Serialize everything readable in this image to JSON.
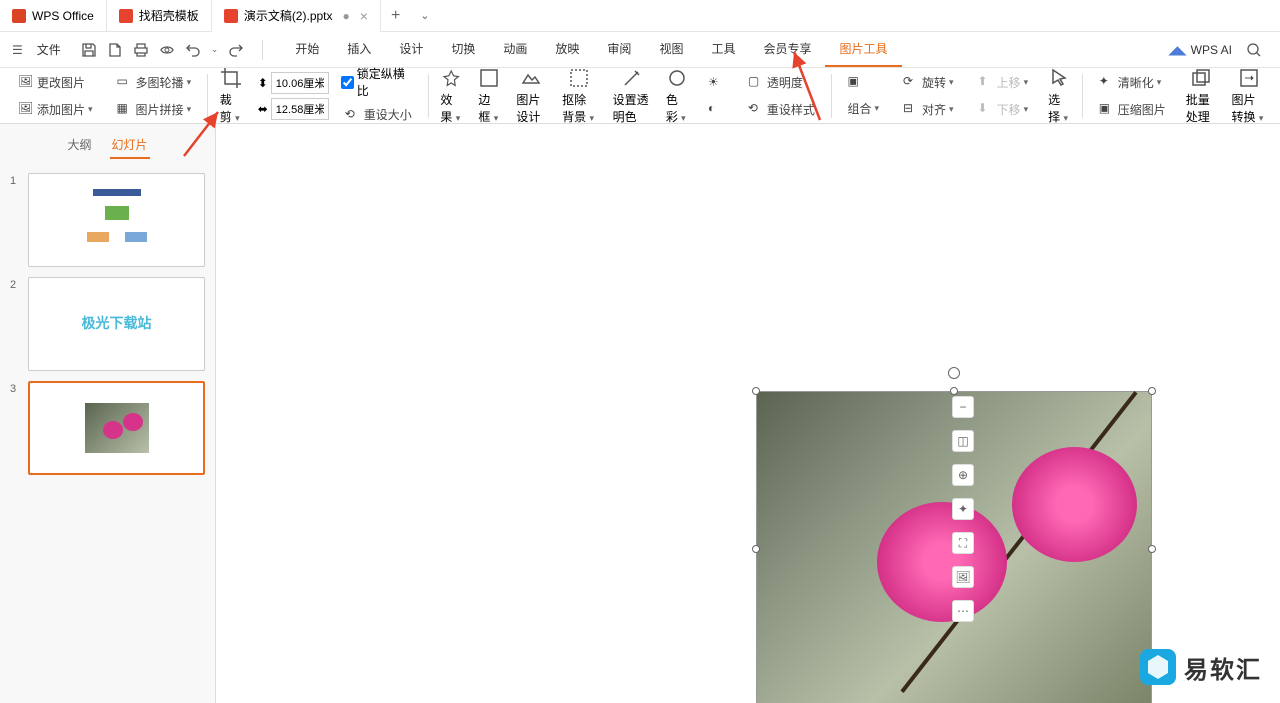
{
  "titlebar": {
    "tabs": [
      {
        "icon": "#d94426",
        "label": "WPS Office"
      },
      {
        "icon": "#e5432e",
        "label": "找稻壳模板"
      },
      {
        "icon": "#e5432e",
        "label": "演示文稿(2).pptx",
        "modified": true
      }
    ]
  },
  "menubar": {
    "file": "文件",
    "tabs": [
      "开始",
      "插入",
      "设计",
      "切换",
      "动画",
      "放映",
      "审阅",
      "视图",
      "工具",
      "会员专享",
      "图片工具"
    ],
    "active": "图片工具",
    "wpsai": "WPS AI"
  },
  "ribbon": {
    "change_image": "更改图片",
    "multi_outline": "多图轮播",
    "insert_image": "添加图片",
    "pic_merge": "图片拼接",
    "crop": "裁剪",
    "height": "10.06厘米",
    "width": "12.58厘米",
    "lock_ratio": "锁定纵横比",
    "reset_size": "重设大小",
    "effects": "效果",
    "border": "边框",
    "pic_design": "图片设计",
    "remove_bg": "抠除背景",
    "set_transparent": "设置透明色",
    "color": "色彩",
    "transparency": "透明度",
    "reset_style": "重设样式",
    "combine": "组合",
    "rotate": "旋转",
    "align": "对齐",
    "move_up": "上移",
    "move_down": "下移",
    "select": "选择",
    "clarity": "清晰化",
    "compress": "压缩图片",
    "batch": "批量处理",
    "convert": "图片转换"
  },
  "sidepanel": {
    "outline": "大纲",
    "slides": "幻灯片",
    "slide2_text": "极光下载站"
  },
  "watermark": "易软汇"
}
